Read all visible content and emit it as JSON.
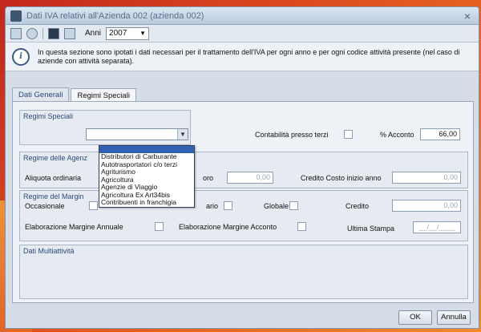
{
  "window": {
    "title": "Dati IVA relativi all'Azienda 002 (azienda 002)"
  },
  "toolbar": {
    "year_label": "Anni",
    "year_value": "2007"
  },
  "info": {
    "text": "In questa sezione sono ipotati i dati necessari per il trattamento dell'IVA per ogni anno e per ogni codice attività presente (nel caso di aziende con attività separata)."
  },
  "tabs": [
    "Dati Generali",
    "Regimi Speciali"
  ],
  "regimi": {
    "group_title": "Regimi Speciali",
    "contabilita_label": "Contabilità presso terzi",
    "acconto_label": "% Acconto",
    "acconto_value": "66,00",
    "dropdown_options": [
      "",
      "Distributori di Carburante",
      "Autotrasportatori c/o terzi",
      "Agriturismo",
      "Agricoltura",
      "Agenzie di Viaggio",
      "Agricoltura Ex Art34bis",
      "Contribuenti in franchigia"
    ]
  },
  "agenzie": {
    "group_title": "Regime delle Agenz",
    "aliquota_label": "Aliquota ordinaria",
    "field_mid_suffix": "oro",
    "field_mid_value": "0,00",
    "credito_costo_label": "Credito Costo inizio anno",
    "credito_costo_value": "0,00"
  },
  "margine": {
    "group_title": "Regime del Margin",
    "occasionale_label": "Occasionale",
    "ario_label": "ario",
    "globale_label": "Globale",
    "credito_label": "Credito",
    "credito_value": "0,00",
    "elab_annuale_label": "Elaborazione Margine Annuale",
    "elab_acconto_label": "Elaborazione Margine Acconto",
    "ultima_stampa_label": "Ultima Stampa",
    "ultima_stampa_value": "__/__/____"
  },
  "multiattivita": {
    "group_title": "Dati Multiattività"
  },
  "buttons": {
    "ok": "OK",
    "annulla": "Annulla"
  }
}
